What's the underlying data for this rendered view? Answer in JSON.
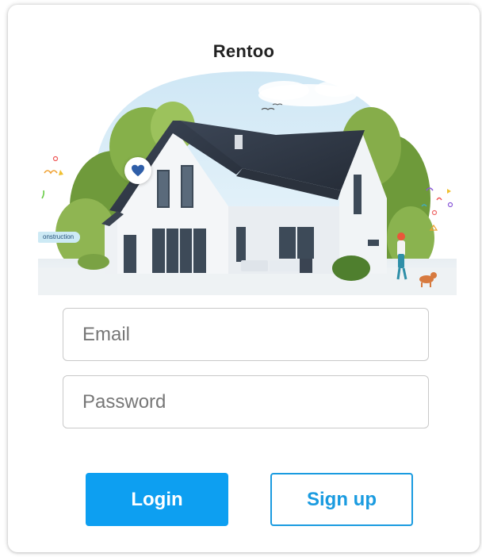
{
  "app": {
    "title": "Rentoo"
  },
  "hero": {
    "badge_text": "onstruction"
  },
  "form": {
    "email": {
      "placeholder": "Email",
      "value": ""
    },
    "password": {
      "placeholder": "Password",
      "value": ""
    }
  },
  "actions": {
    "login_label": "Login",
    "signup_label": "Sign up"
  },
  "colors": {
    "primary": "#0d9ff1",
    "secondary_border": "#1a9be0",
    "heart": "#2f5ea8"
  },
  "icons": {
    "favorite": "heart-icon"
  }
}
